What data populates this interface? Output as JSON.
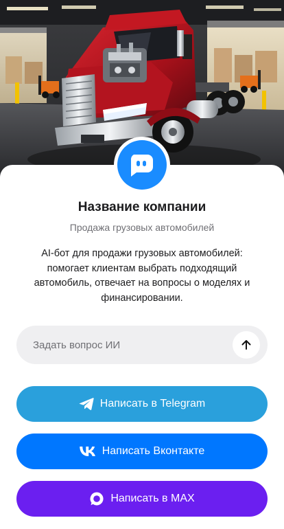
{
  "hero": {
    "image_name": "truck-in-warehouse-illustration",
    "truck_color": "#b0121d"
  },
  "company": {
    "name": "Название компании",
    "subtitle": "Продажа грузовых автомобилей",
    "description": "AI-бот для продажи грузовых автомобилей: помогает клиентам выбрать подходящий автомобиль, отвечает на вопросы о моделях и финансировании.",
    "avatar_icon": "chat-bot-icon",
    "avatar_color": "#1a8cff"
  },
  "ask": {
    "placeholder": "Задать вопрос ИИ",
    "value": "",
    "send_icon": "arrow-up-icon"
  },
  "buttons": [
    {
      "label": "Написать в Telegram",
      "icon": "telegram-icon",
      "color": "#2aa0dc"
    },
    {
      "label": "Написать Вконтакте",
      "icon": "vk-icon",
      "color": "#0077ff"
    },
    {
      "label": "Написать в MAX",
      "icon": "max-icon",
      "color": "#6b1ff0"
    }
  ]
}
